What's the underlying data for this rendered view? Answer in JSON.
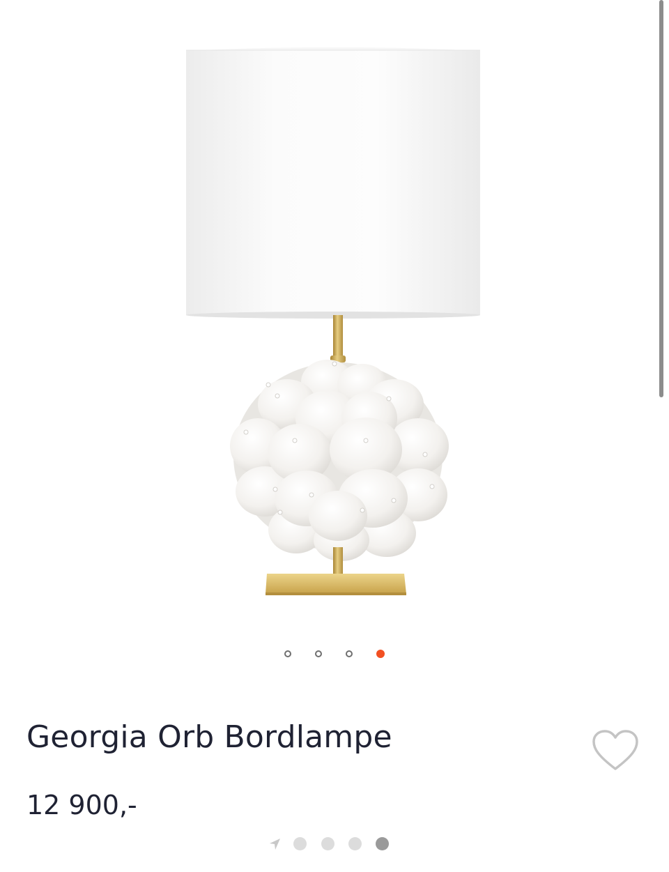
{
  "product": {
    "name": "Georgia Orb Bordlampe",
    "price": "12 900,-"
  },
  "carousel": {
    "slide_count": 4,
    "active_index": 3
  },
  "page_indicator": {
    "page_count": 4,
    "active_index": 3
  },
  "icons": {
    "favorite": "heart-outline-icon",
    "location": "location-arrow-icon"
  },
  "colors": {
    "accent": "#f25022",
    "text": "#1f2233",
    "brass": "#c9a54c"
  }
}
